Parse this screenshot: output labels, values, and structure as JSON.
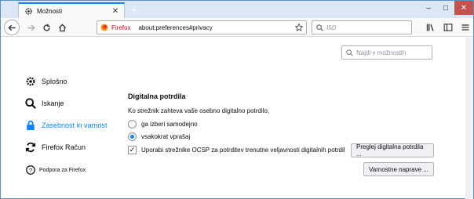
{
  "tab": {
    "title": "Možnosti"
  },
  "navbar": {
    "brand": "Firefox",
    "url": "about:preferences#privacy",
    "search_placeholder": "Išči"
  },
  "prefs_search": {
    "placeholder": "Najdi v možnostih"
  },
  "sidebar": {
    "items": [
      {
        "label": "Splošno",
        "icon": "gear-icon"
      },
      {
        "label": "Iskanje",
        "icon": "search-icon"
      },
      {
        "label": "Zasebnost in varnost",
        "icon": "lock-icon",
        "selected": true
      },
      {
        "label": "Firefox Račun",
        "icon": "sync-icon"
      }
    ],
    "support": "Podpora za Firefox"
  },
  "certificates": {
    "heading": "Digitalna potrdila",
    "question": "Ko strežnik zahteva vaše osebno digitalno potrdilo,",
    "options": [
      {
        "label": "ga izberi samodejno",
        "selected": false
      },
      {
        "label": "vsakokrat vprašaj",
        "selected": true
      }
    ],
    "ocsp": {
      "label": "Uporabi strežnike OCSP za potrditev trenutne veljavnosti digitalnih potrdil",
      "checked": true
    },
    "view_button": "Preglej digitalna potrdila ...",
    "devices_button": "Varnostne naprave ..."
  },
  "colors": {
    "accent": "#0a84ff",
    "brand": "#d70022"
  }
}
